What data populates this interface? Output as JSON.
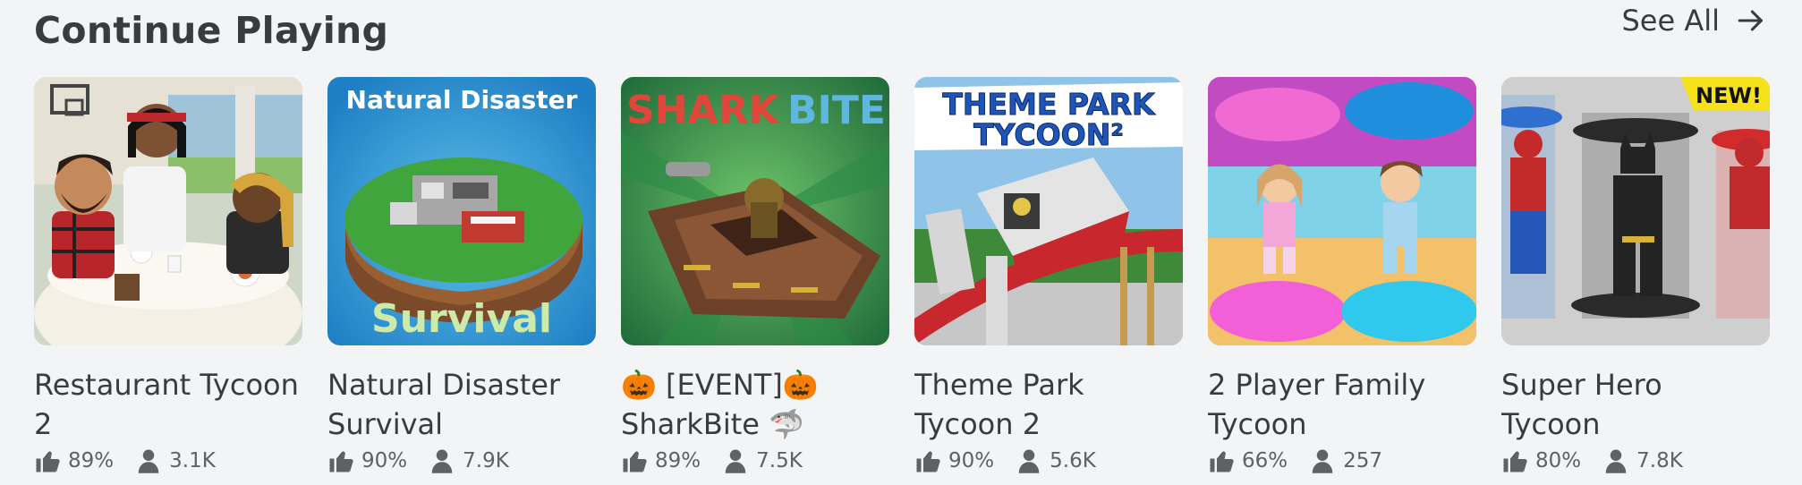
{
  "section": {
    "title": "Continue Playing",
    "see_all_label": "See All"
  },
  "games": [
    {
      "name": "Restaurant Tycoon 2",
      "rating": "89%",
      "players": "3.1K",
      "thumbnail_text": []
    },
    {
      "name": "Natural Disaster Survival",
      "rating": "90%",
      "players": "7.9K",
      "thumbnail_text": [
        "Natural  Disaster",
        "Survival"
      ]
    },
    {
      "name": "🎃 [EVENT]🎃 SharkBite 🦈",
      "rating": "89%",
      "players": "7.5K",
      "thumbnail_text": [
        "SHARK",
        "BITE"
      ]
    },
    {
      "name": "Theme Park Tycoon 2",
      "rating": "90%",
      "players": "5.6K",
      "thumbnail_text": [
        "THEME PARK",
        "TYCOON²"
      ]
    },
    {
      "name": "2 Player Family Tycoon",
      "rating": "66%",
      "players": "257",
      "thumbnail_text": []
    },
    {
      "name": "Super Hero Tycoon",
      "rating": "80%",
      "players": "7.8K",
      "thumbnail_text": [
        "NEW!"
      ]
    }
  ],
  "icons": {
    "see_all": "arrow-right-icon",
    "rating": "thumbs-up-icon",
    "players": "player-icon"
  },
  "colors": {
    "background": "#f2f4f5",
    "text": "#393b3d",
    "meta_text": "#606162"
  }
}
